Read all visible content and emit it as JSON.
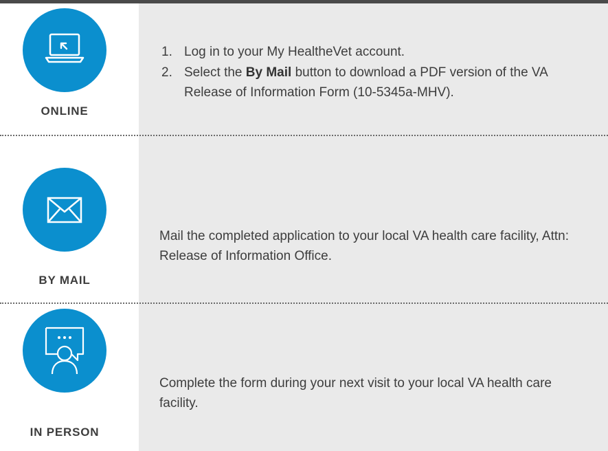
{
  "methods": [
    {
      "label": "ONLINE",
      "icon": "laptop-cursor-icon",
      "steps": [
        {
          "num": "1.",
          "text": "Log in to your My HealtheVet account."
        },
        {
          "num": "2.",
          "pre": "Select the ",
          "bold": "By Mail",
          "post": " button to download a PDF version of the VA Release of Information Form (10-5345a-MHV)."
        }
      ]
    },
    {
      "label": "BY MAIL",
      "icon": "envelope-icon",
      "text": "Mail the completed application to your local VA health care facility, Attn: Release of Information Office."
    },
    {
      "label": "IN PERSON",
      "icon": "person-speech-bubble-icon",
      "text": "Complete the form during your next visit to your local VA health care facility."
    }
  ],
  "colors": {
    "accent": "#0b8fce",
    "panel": "#eaeaea",
    "text": "#3d3d3d"
  }
}
